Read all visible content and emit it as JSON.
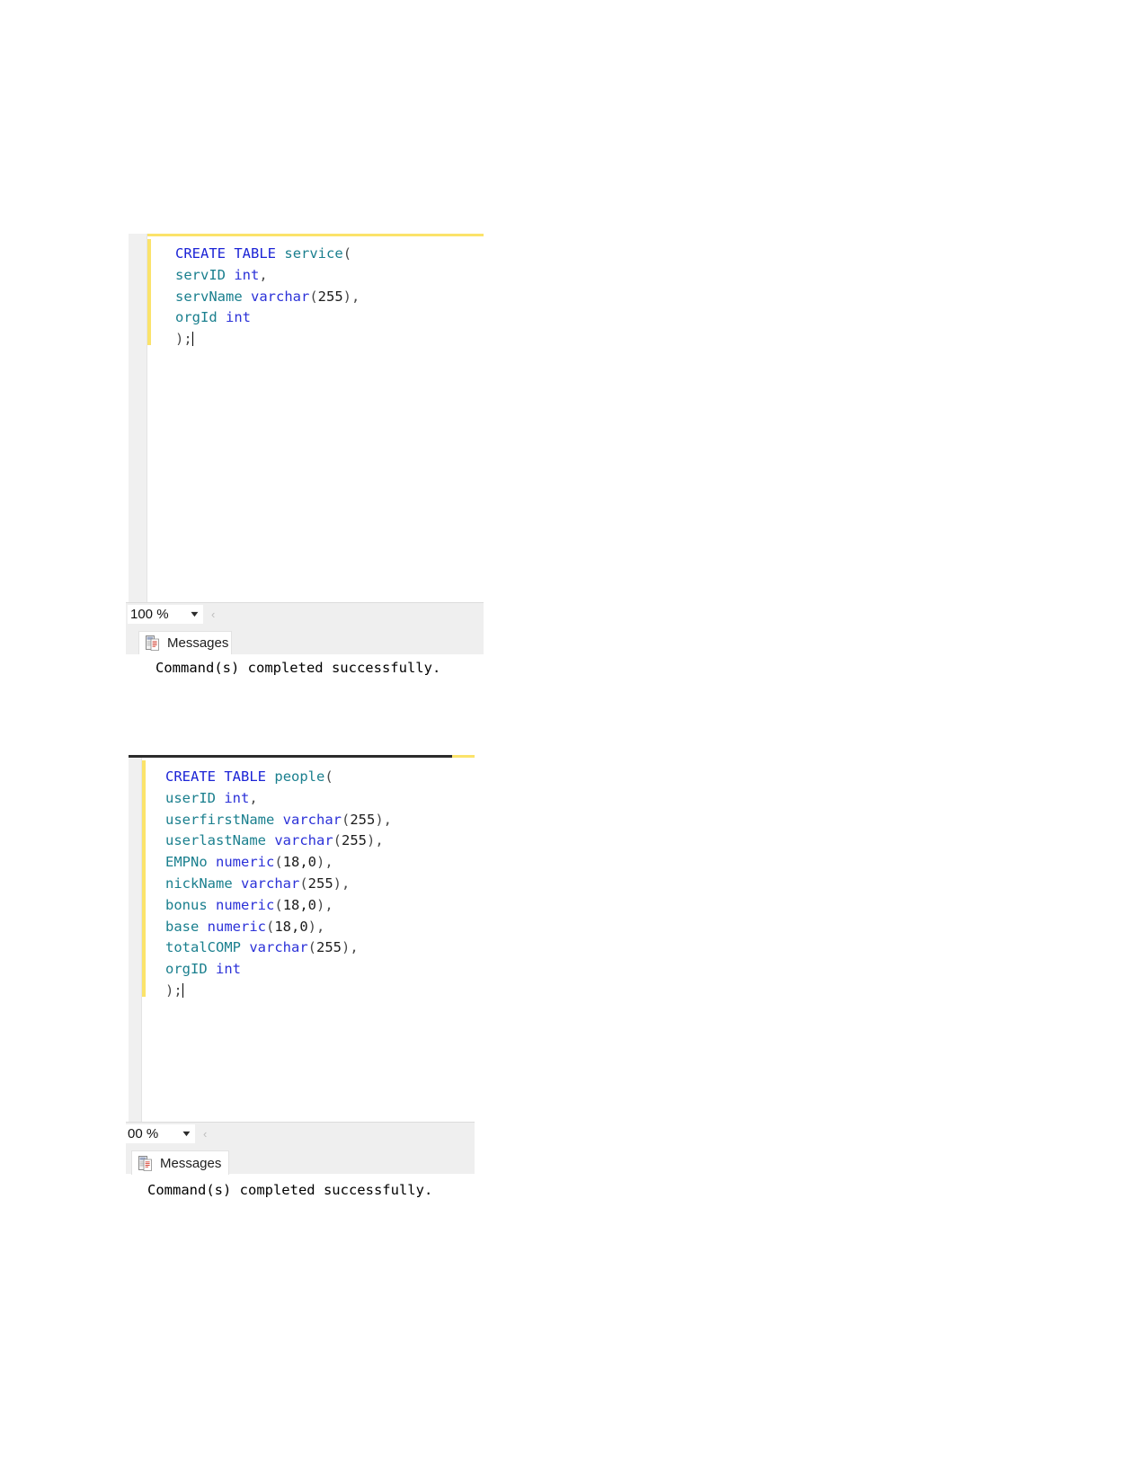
{
  "document": {
    "background": "#ffffff",
    "page_size": "1275x1650"
  },
  "theme": {
    "keyword_color": "#1c24d6",
    "identifier_color": "#1a7f8e",
    "type_color": "#2b31d8",
    "punctuation_color": "#4a4a4a",
    "change_bar_color": "#fbe36a",
    "margin_color": "#f0f0f0",
    "strip_color": "#efefef"
  },
  "panels": [
    {
      "id": "service-table",
      "query_editor": {
        "lines": [
          {
            "indent": 0,
            "tokens": [
              {
                "t": "CREATE",
                "c": "kw"
              },
              {
                "t": " ",
                "c": "punc"
              },
              {
                "t": "TABLE",
                "c": "kw"
              },
              {
                "t": " ",
                "c": "punc"
              },
              {
                "t": "service",
                "c": "tbl"
              },
              {
                "t": "(",
                "c": "punc"
              }
            ]
          },
          {
            "indent": 0,
            "tokens": [
              {
                "t": "servID",
                "c": "ident"
              },
              {
                "t": " ",
                "c": "punc"
              },
              {
                "t": "int",
                "c": "type"
              },
              {
                "t": ",",
                "c": "punc"
              }
            ]
          },
          {
            "indent": 0,
            "tokens": [
              {
                "t": "servName",
                "c": "ident"
              },
              {
                "t": " ",
                "c": "punc"
              },
              {
                "t": "varchar",
                "c": "type"
              },
              {
                "t": "(",
                "c": "punc"
              },
              {
                "t": "255",
                "c": "num"
              },
              {
                "t": "),",
                "c": "punc"
              }
            ]
          },
          {
            "indent": 0,
            "tokens": [
              {
                "t": "orgId",
                "c": "ident"
              },
              {
                "t": " ",
                "c": "punc"
              },
              {
                "t": "int",
                "c": "type"
              }
            ]
          },
          {
            "indent": 0,
            "tokens": [
              {
                "t": ");",
                "c": "punc"
              }
            ],
            "caret": true
          }
        ],
        "plain_text": "CREATE TABLE service(\nservID int,\nservName varchar(255),\norgId int\n);"
      },
      "zoom_control": {
        "value": "100 %",
        "arrow": "▼"
      },
      "hscroll_left_glyph": "‹",
      "results": {
        "tab_label": "Messages",
        "tab_icon": "messages-icon",
        "message": "Command(s) completed successfully."
      }
    },
    {
      "id": "people-table",
      "query_editor": {
        "lines": [
          {
            "indent": 0,
            "tokens": [
              {
                "t": "CREATE",
                "c": "kw"
              },
              {
                "t": " ",
                "c": "punc"
              },
              {
                "t": "TABLE",
                "c": "kw"
              },
              {
                "t": " ",
                "c": "punc"
              },
              {
                "t": "people",
                "c": "tbl"
              },
              {
                "t": "(",
                "c": "punc"
              }
            ]
          },
          {
            "indent": 0,
            "tokens": [
              {
                "t": "userID",
                "c": "ident"
              },
              {
                "t": " ",
                "c": "punc"
              },
              {
                "t": "int",
                "c": "type"
              },
              {
                "t": ",",
                "c": "punc"
              }
            ]
          },
          {
            "indent": 0,
            "tokens": [
              {
                "t": "userfirstName",
                "c": "ident"
              },
              {
                "t": " ",
                "c": "punc"
              },
              {
                "t": "varchar",
                "c": "type"
              },
              {
                "t": "(",
                "c": "punc"
              },
              {
                "t": "255",
                "c": "num"
              },
              {
                "t": "),",
                "c": "punc"
              }
            ]
          },
          {
            "indent": 0,
            "tokens": [
              {
                "t": "userlastName",
                "c": "ident"
              },
              {
                "t": " ",
                "c": "punc"
              },
              {
                "t": "varchar",
                "c": "type"
              },
              {
                "t": "(",
                "c": "punc"
              },
              {
                "t": "255",
                "c": "num"
              },
              {
                "t": "),",
                "c": "punc"
              }
            ]
          },
          {
            "indent": 0,
            "tokens": [
              {
                "t": "EMPNo",
                "c": "ident"
              },
              {
                "t": " ",
                "c": "punc"
              },
              {
                "t": "numeric",
                "c": "type"
              },
              {
                "t": "(",
                "c": "punc"
              },
              {
                "t": "18,0",
                "c": "num"
              },
              {
                "t": "),",
                "c": "punc"
              }
            ]
          },
          {
            "indent": 0,
            "tokens": [
              {
                "t": "nickName",
                "c": "ident"
              },
              {
                "t": " ",
                "c": "punc"
              },
              {
                "t": "varchar",
                "c": "type"
              },
              {
                "t": "(",
                "c": "punc"
              },
              {
                "t": "255",
                "c": "num"
              },
              {
                "t": "),",
                "c": "punc"
              }
            ]
          },
          {
            "indent": 0,
            "tokens": [
              {
                "t": "bonus",
                "c": "ident"
              },
              {
                "t": " ",
                "c": "punc"
              },
              {
                "t": "numeric",
                "c": "type"
              },
              {
                "t": "(",
                "c": "punc"
              },
              {
                "t": "18,0",
                "c": "num"
              },
              {
                "t": "),",
                "c": "punc"
              }
            ]
          },
          {
            "indent": 0,
            "tokens": [
              {
                "t": "base",
                "c": "ident"
              },
              {
                "t": " ",
                "c": "punc"
              },
              {
                "t": "numeric",
                "c": "type"
              },
              {
                "t": "(",
                "c": "punc"
              },
              {
                "t": "18,0",
                "c": "num"
              },
              {
                "t": "),",
                "c": "punc"
              }
            ]
          },
          {
            "indent": 0,
            "tokens": [
              {
                "t": "totalCOMP",
                "c": "ident"
              },
              {
                "t": " ",
                "c": "punc"
              },
              {
                "t": "varchar",
                "c": "type"
              },
              {
                "t": "(",
                "c": "punc"
              },
              {
                "t": "255",
                "c": "num"
              },
              {
                "t": "),",
                "c": "punc"
              }
            ]
          },
          {
            "indent": 0,
            "tokens": [
              {
                "t": "orgID",
                "c": "ident"
              },
              {
                "t": " ",
                "c": "punc"
              },
              {
                "t": "int",
                "c": "type"
              }
            ]
          },
          {
            "indent": 0,
            "tokens": [
              {
                "t": ");",
                "c": "punc"
              }
            ],
            "caret": true
          }
        ],
        "plain_text": "CREATE TABLE people(\nuserID int,\nuserfirstName varchar(255),\nuserlastName varchar(255),\nEMPNo numeric(18,0),\nnickName varchar(255),\nbonus numeric(18,0),\nbase numeric(18,0),\ntotalCOMP varchar(255),\norgID int\n);"
      },
      "zoom_control": {
        "value": "00 %",
        "arrow": "▼"
      },
      "hscroll_left_glyph": "‹",
      "results": {
        "tab_label": "Messages",
        "tab_icon": "messages-icon",
        "message": "Command(s) completed successfully."
      }
    }
  ]
}
